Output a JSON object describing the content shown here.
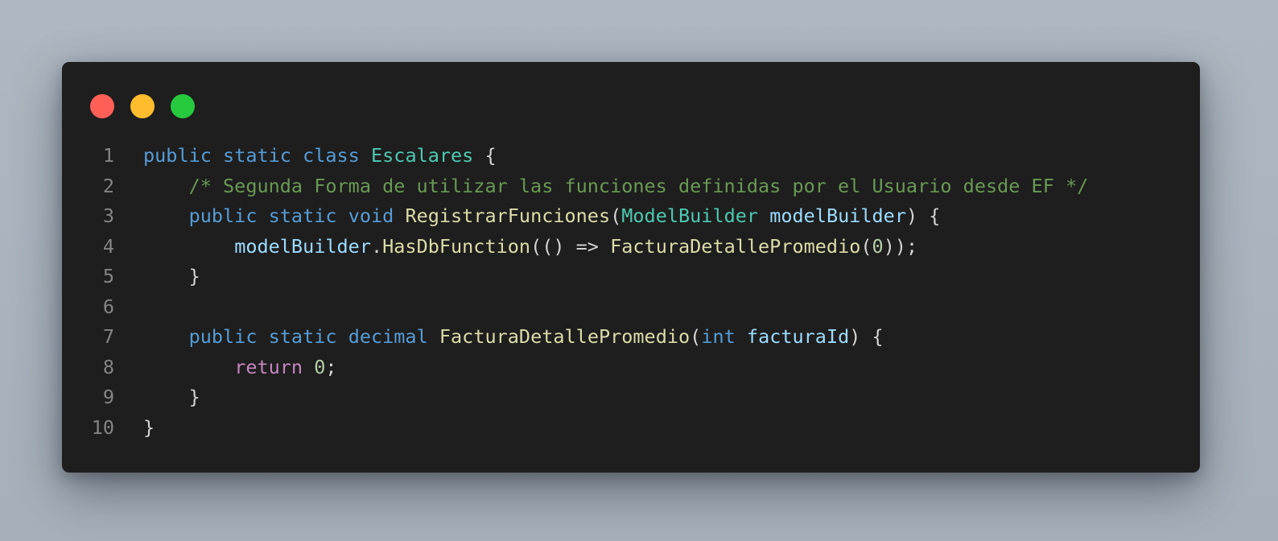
{
  "window": {
    "controls": {
      "close_color": "#ff5f56",
      "minimize_color": "#ffbd2e",
      "maximize_color": "#27c93f"
    }
  },
  "colors": {
    "background": "#a9b3bd",
    "editor": "#1e1e1e",
    "keyword": "#569cd6",
    "control": "#c586c0",
    "type": "#4ec9b0",
    "function": "#dcdcaa",
    "variable": "#9cdcfe",
    "number": "#b5cea8",
    "comment": "#6a9955",
    "punctuation": "#d4d4d4",
    "line_number": "#858585"
  },
  "code": {
    "lines": [
      {
        "number": "1",
        "tokens": [
          {
            "t": "public",
            "c": "kw"
          },
          {
            "t": " ",
            "c": "pn"
          },
          {
            "t": "static",
            "c": "kw"
          },
          {
            "t": " ",
            "c": "pn"
          },
          {
            "t": "class",
            "c": "kw"
          },
          {
            "t": " ",
            "c": "pn"
          },
          {
            "t": "Escalares",
            "c": "ty"
          },
          {
            "t": " {",
            "c": "pn"
          }
        ]
      },
      {
        "number": "2",
        "tokens": [
          {
            "t": "    ",
            "c": "pn"
          },
          {
            "t": "/* Segunda Forma de utilizar las funciones definidas por el Usuario desde EF */",
            "c": "cm"
          }
        ]
      },
      {
        "number": "3",
        "tokens": [
          {
            "t": "    ",
            "c": "pn"
          },
          {
            "t": "public",
            "c": "kw"
          },
          {
            "t": " ",
            "c": "pn"
          },
          {
            "t": "static",
            "c": "kw"
          },
          {
            "t": " ",
            "c": "pn"
          },
          {
            "t": "void",
            "c": "kw"
          },
          {
            "t": " ",
            "c": "pn"
          },
          {
            "t": "RegistrarFunciones",
            "c": "fn"
          },
          {
            "t": "(",
            "c": "pn"
          },
          {
            "t": "ModelBuilder",
            "c": "ty"
          },
          {
            "t": " ",
            "c": "pn"
          },
          {
            "t": "modelBuilder",
            "c": "var"
          },
          {
            "t": ") {",
            "c": "pn"
          }
        ]
      },
      {
        "number": "4",
        "tokens": [
          {
            "t": "        ",
            "c": "pn"
          },
          {
            "t": "modelBuilder",
            "c": "var"
          },
          {
            "t": ".",
            "c": "pn"
          },
          {
            "t": "HasDbFunction",
            "c": "fn"
          },
          {
            "t": "(() => ",
            "c": "pn"
          },
          {
            "t": "FacturaDetallePromedio",
            "c": "fn"
          },
          {
            "t": "(",
            "c": "pn"
          },
          {
            "t": "0",
            "c": "num"
          },
          {
            "t": "));",
            "c": "pn"
          }
        ]
      },
      {
        "number": "5",
        "tokens": [
          {
            "t": "    }",
            "c": "pn"
          }
        ]
      },
      {
        "number": "6",
        "tokens": []
      },
      {
        "number": "7",
        "tokens": [
          {
            "t": "    ",
            "c": "pn"
          },
          {
            "t": "public",
            "c": "kw"
          },
          {
            "t": " ",
            "c": "pn"
          },
          {
            "t": "static",
            "c": "kw"
          },
          {
            "t": " ",
            "c": "pn"
          },
          {
            "t": "decimal",
            "c": "kw"
          },
          {
            "t": " ",
            "c": "pn"
          },
          {
            "t": "FacturaDetallePromedio",
            "c": "fn"
          },
          {
            "t": "(",
            "c": "pn"
          },
          {
            "t": "int",
            "c": "kw"
          },
          {
            "t": " ",
            "c": "pn"
          },
          {
            "t": "facturaId",
            "c": "var"
          },
          {
            "t": ") {",
            "c": "pn"
          }
        ]
      },
      {
        "number": "8",
        "tokens": [
          {
            "t": "        ",
            "c": "pn"
          },
          {
            "t": "return",
            "c": "ctl"
          },
          {
            "t": " ",
            "c": "pn"
          },
          {
            "t": "0",
            "c": "num"
          },
          {
            "t": ";",
            "c": "pn"
          }
        ]
      },
      {
        "number": "9",
        "tokens": [
          {
            "t": "    }",
            "c": "pn"
          }
        ]
      },
      {
        "number": "10",
        "tokens": [
          {
            "t": "}",
            "c": "pn"
          }
        ]
      }
    ]
  }
}
